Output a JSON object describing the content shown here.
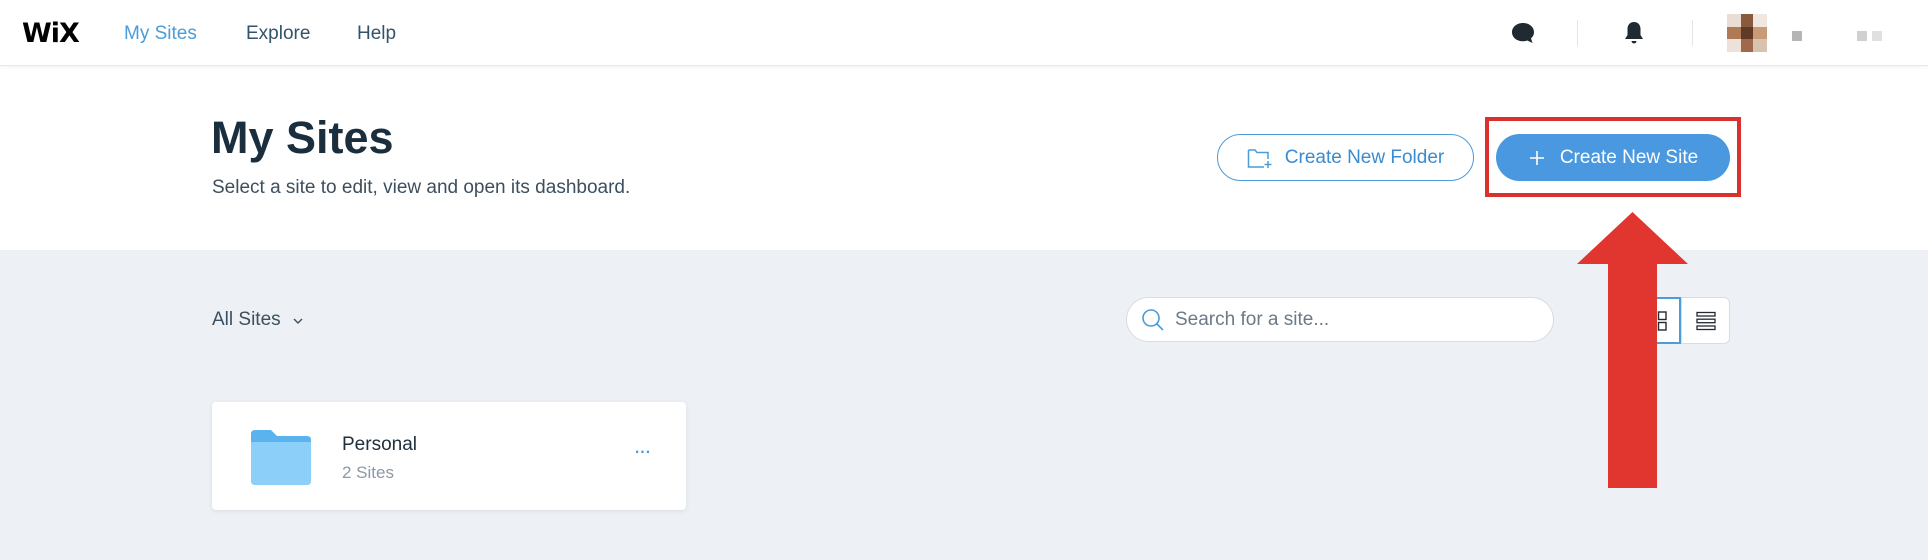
{
  "topbar": {
    "logo": "WiX",
    "nav": [
      {
        "label": "My Sites",
        "active": true
      },
      {
        "label": "Explore",
        "active": false
      },
      {
        "label": "Help",
        "active": false
      }
    ],
    "icons": [
      "chat-icon",
      "bell-icon"
    ],
    "accent_color": "#4b9cd8"
  },
  "header": {
    "title": "My Sites",
    "subtitle": "Select a site to edit, view and open its dashboard.",
    "create_folder_label": "Create New Folder",
    "create_site_label": "Create New Site",
    "primary_color": "#4a98e0"
  },
  "toolbar": {
    "filter_label": "All Sites",
    "search_placeholder": "Search for a site...",
    "view_modes": [
      "grid",
      "list"
    ],
    "active_view": "grid"
  },
  "folders": [
    {
      "name": "Personal",
      "count": "2 Sites",
      "more": "..."
    }
  ],
  "annotation": {
    "highlight_color": "#d8312e",
    "target": "create_site_button"
  }
}
